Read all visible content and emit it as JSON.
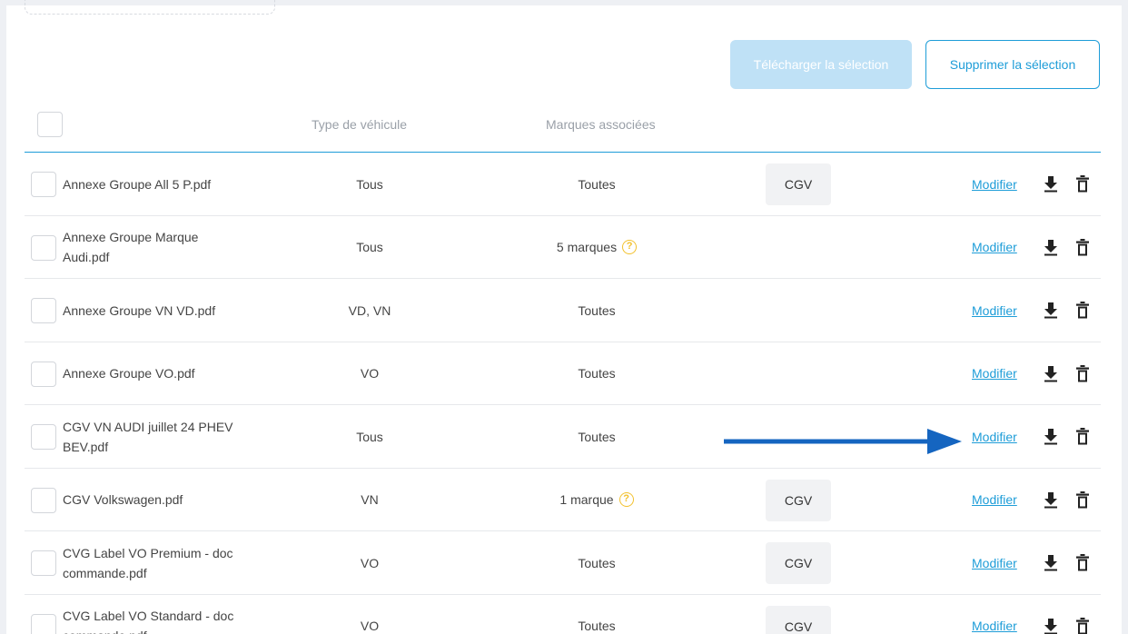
{
  "toolbar": {
    "download_selection_label": "Télécharger la sélection",
    "delete_selection_label": "Supprimer la sélection"
  },
  "table": {
    "columns": {
      "vehicle_type": "Type de véhicule",
      "brands": "Marques associées"
    },
    "action_label": "Modifier",
    "rows": [
      {
        "name": "Annexe Groupe All 5 P.pdf",
        "vehicle_type": "Tous",
        "brands": "Toutes",
        "has_help": false,
        "badge": "CGV"
      },
      {
        "name": "Annexe Groupe Marque Audi.pdf",
        "vehicle_type": "Tous",
        "brands": "5 marques",
        "has_help": true,
        "badge": ""
      },
      {
        "name": "Annexe Groupe VN VD.pdf",
        "vehicle_type": "VD, VN",
        "brands": "Toutes",
        "has_help": false,
        "badge": ""
      },
      {
        "name": "Annexe Groupe VO.pdf",
        "vehicle_type": "VO",
        "brands": "Toutes",
        "has_help": false,
        "badge": ""
      },
      {
        "name": "CGV VN AUDI juillet 24 PHEV BEV.pdf",
        "vehicle_type": "Tous",
        "brands": "Toutes",
        "has_help": false,
        "badge": ""
      },
      {
        "name": "CGV Volkswagen.pdf",
        "vehicle_type": "VN",
        "brands": "1 marque",
        "has_help": true,
        "badge": "CGV"
      },
      {
        "name": "CVG Label VO Premium - doc commande.pdf",
        "vehicle_type": "VO",
        "brands": "Toutes",
        "has_help": false,
        "badge": "CGV"
      },
      {
        "name": "CVG Label VO Standard - doc commande.pdf",
        "vehicle_type": "VO",
        "brands": "Toutes",
        "has_help": false,
        "badge": "CGV"
      }
    ]
  },
  "annotation": {
    "arrow_target_row": 4,
    "arrow_color": "#1565c0"
  },
  "colors": {
    "accent": "#1e9dd8",
    "help": "#f2c12e",
    "disabled_button": "#bfe1f6"
  },
  "icons": {
    "download": "download-icon",
    "trash": "trash-icon",
    "help": "help-icon"
  }
}
